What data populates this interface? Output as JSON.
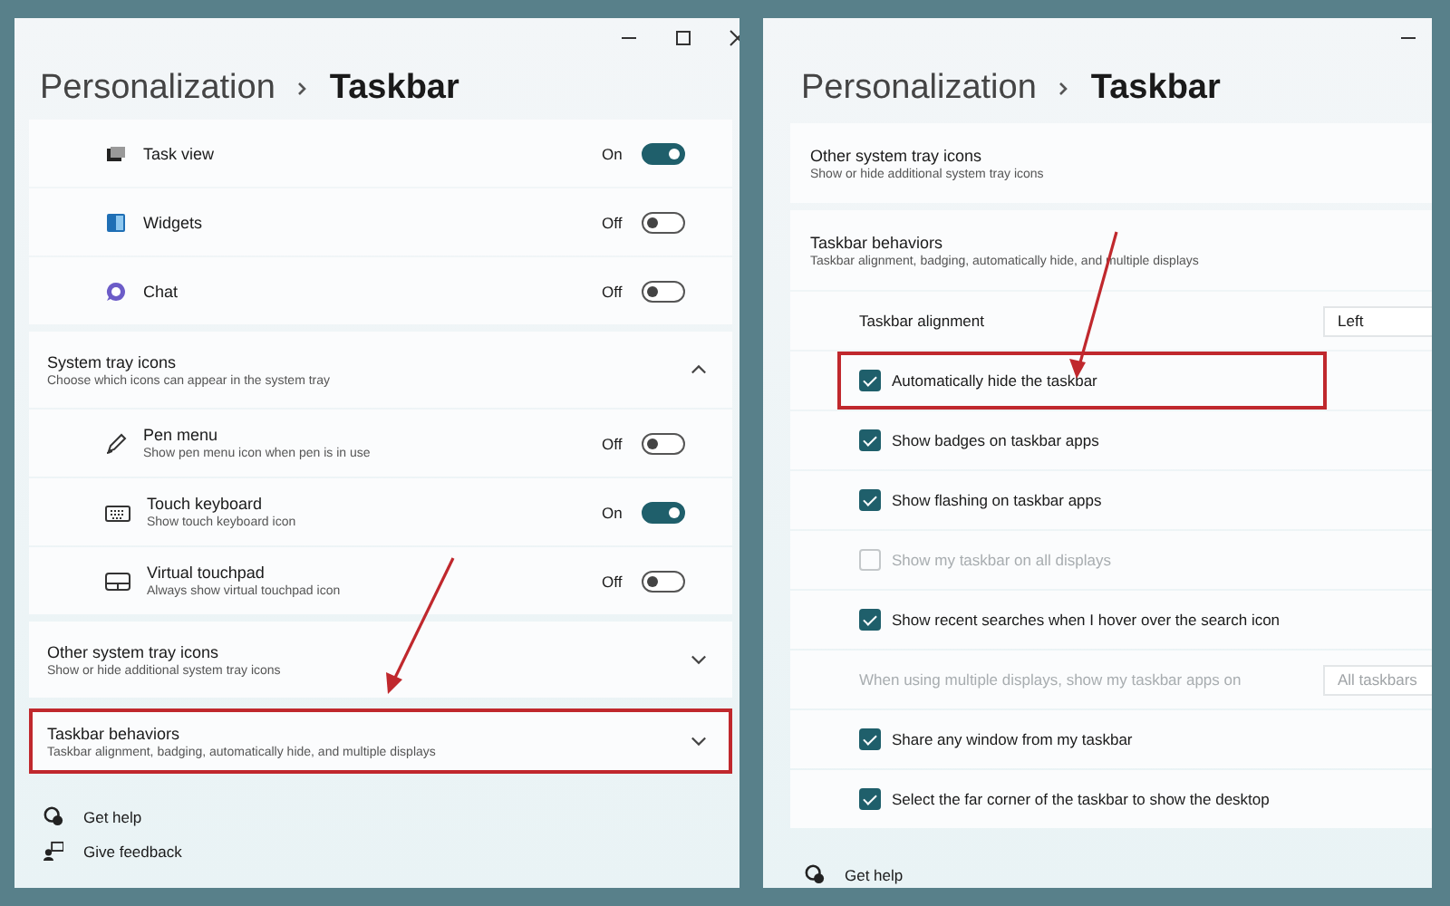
{
  "left_window": {
    "breadcrumb": {
      "parent": "Personalization",
      "current": "Taskbar"
    },
    "taskbar_items": [
      {
        "title": "Task view",
        "state_label": "On",
        "on": true
      },
      {
        "title": "Widgets",
        "state_label": "Off",
        "on": false
      },
      {
        "title": "Chat",
        "state_label": "Off",
        "on": false
      }
    ],
    "system_tray": {
      "title": "System tray icons",
      "description": "Choose which icons can appear in the system tray",
      "expanded": true,
      "items": [
        {
          "title": "Pen menu",
          "description": "Show pen menu icon when pen is in use",
          "state_label": "Off",
          "on": false
        },
        {
          "title": "Touch keyboard",
          "description": "Show touch keyboard icon",
          "state_label": "On",
          "on": true
        },
        {
          "title": "Virtual touchpad",
          "description": "Always show virtual touchpad icon",
          "state_label": "Off",
          "on": false
        }
      ]
    },
    "expanders": [
      {
        "title": "Other system tray icons",
        "description": "Show or hide additional system tray icons",
        "expanded": false,
        "highlighted": false
      },
      {
        "title": "Taskbar behaviors",
        "description": "Taskbar alignment, badging, automatically hide, and multiple displays",
        "expanded": false,
        "highlighted": true
      }
    ],
    "footer_links": [
      "Get help",
      "Give feedback"
    ]
  },
  "right_window": {
    "breadcrumb": {
      "parent": "Personalization",
      "current": "Taskbar"
    },
    "other_tray": {
      "title": "Other system tray icons",
      "description": "Show or hide additional system tray icons"
    },
    "behaviors": {
      "title": "Taskbar behaviors",
      "description": "Taskbar alignment, badging, automatically hide, and multiple displays",
      "rows": [
        {
          "kind": "dropdown",
          "label": "Taskbar alignment",
          "value": "Left",
          "disabled": false
        },
        {
          "kind": "checkbox",
          "label": "Automatically hide the taskbar",
          "checked": true,
          "disabled": false,
          "highlighted": true
        },
        {
          "kind": "checkbox",
          "label": "Show badges on taskbar apps",
          "checked": true,
          "disabled": false,
          "highlighted": false
        },
        {
          "kind": "checkbox",
          "label": "Show flashing on taskbar apps",
          "checked": true,
          "disabled": false,
          "highlighted": false
        },
        {
          "kind": "checkbox",
          "label": "Show my taskbar on all displays",
          "checked": false,
          "disabled": true,
          "highlighted": false
        },
        {
          "kind": "checkbox",
          "label": "Show recent searches when I hover over the search icon",
          "checked": true,
          "disabled": false,
          "highlighted": false
        },
        {
          "kind": "dropdown",
          "label": "When using multiple displays, show my taskbar apps on",
          "value": "All taskbars",
          "disabled": true
        },
        {
          "kind": "checkbox",
          "label": "Share any window from my taskbar",
          "checked": true,
          "disabled": false,
          "highlighted": false
        },
        {
          "kind": "checkbox",
          "label": "Select the far corner of the taskbar to show the desktop",
          "checked": true,
          "disabled": false,
          "highlighted": false
        }
      ]
    },
    "footer_links": [
      "Get help"
    ]
  }
}
